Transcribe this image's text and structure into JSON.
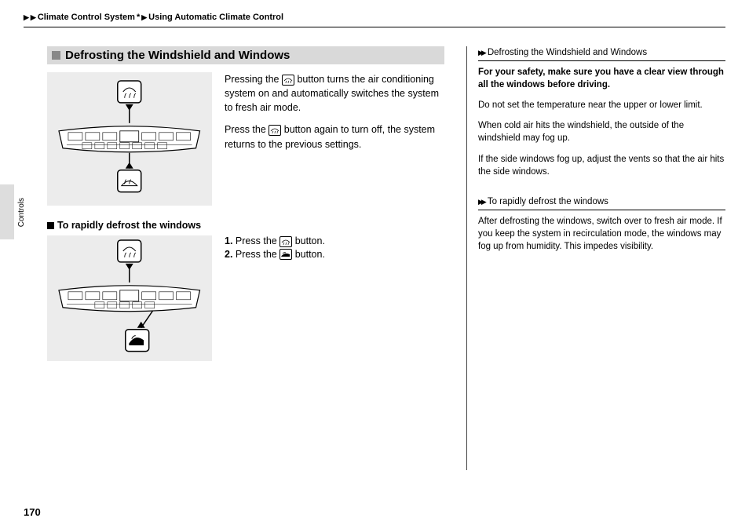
{
  "breadcrumb": {
    "seg1": "Climate Control System",
    "star": "*",
    "seg2": "Using Automatic Climate Control"
  },
  "main": {
    "section_title": "Defrosting the Windshield and Windows",
    "para1": "Pressing the",
    "para1_cont": "button turns the air conditioning system on and automatically switches the system to fresh air mode.",
    "para2": "Press the",
    "para2_cont": "button again to turn off, the system returns to the previous settings.",
    "subhead": "To rapidly defrost the windows",
    "step1_num": "1.",
    "step1_a": "Press the",
    "step1_b": "button.",
    "step2_num": "2.",
    "step2_a": "Press the",
    "step2_b": "button."
  },
  "sidebar": {
    "head1": "Defrosting the Windshield and Windows",
    "bold1": "For your safety, make sure you have a clear view through all the windows before driving.",
    "p1": "Do not set the temperature near the upper or lower limit.",
    "p2": "When cold air hits the windshield, the outside of the windshield may fog up.",
    "p3": "If the side windows fog up, adjust the vents so that the air hits the side windows.",
    "head2": "To rapidly defrost the windows",
    "p4": "After defrosting the windows, switch over to fresh air mode. If you keep the system in recirculation mode, the windows may fog up from humidity. This impedes visibility."
  },
  "page_number": "170",
  "side_tab": "Controls",
  "icons": {
    "defrost": "defrost-icon",
    "recirc": "recirculation-icon"
  }
}
